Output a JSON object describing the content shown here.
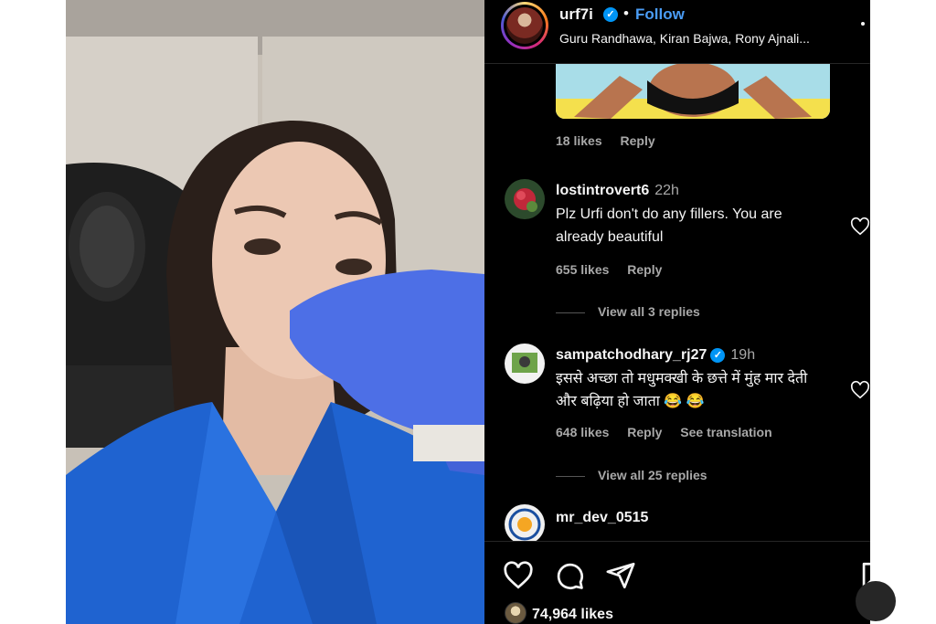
{
  "post": {
    "username": "urf7i",
    "verified_mark": "✓",
    "separator": "•",
    "follow_label": "Follow",
    "audio_subtitle": "Guru Randhawa, Kiran Bajwa, Rony Ajnali..."
  },
  "top_comment": {
    "likes": "18 likes",
    "reply_label": "Reply"
  },
  "comments": [
    {
      "username": "lostintrovert6",
      "time": "22h",
      "text": "Plz Urfi don't do any fillers. You are already beautiful",
      "likes": "655 likes",
      "reply_label": "Reply",
      "view_replies": "View all 3 replies"
    },
    {
      "username": "sampatchodhary_rj27",
      "verified_mark": "✓",
      "time": "19h",
      "text": "इससे अच्छा तो मधुमक्खी के छत्ते में मुंह मार देती और बढ़िया हो जाता 😂 😂",
      "likes": "648 likes",
      "reply_label": "Reply",
      "translation_label": "See translation",
      "view_replies": "View all 25 replies"
    },
    {
      "username": "mr_dev_0515"
    }
  ],
  "footer": {
    "likes_count": "74,964 likes"
  },
  "icons": [
    "heart-icon",
    "comment-icon",
    "share-icon",
    "bookmark-icon"
  ],
  "colors": {
    "panel_bg": "#000000",
    "follow": "#4a9cf5",
    "verified": "#0095f6",
    "muted_text": "#a8a8a8"
  }
}
